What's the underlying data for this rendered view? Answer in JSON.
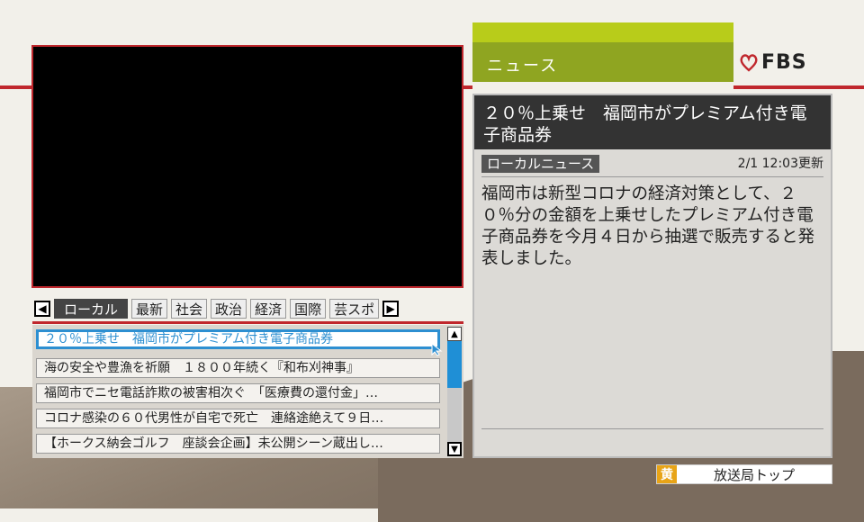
{
  "header": {
    "section_label": "ニュース",
    "logo_text": "FBS",
    "accent_color": "#8fa521",
    "brand_red": "#c0272d"
  },
  "tabs": {
    "prev_icon": "chevron-left-icon",
    "next_icon": "chevron-right-icon",
    "items": [
      {
        "label": "ローカル",
        "active": true
      },
      {
        "label": "最新"
      },
      {
        "label": "社会"
      },
      {
        "label": "政治"
      },
      {
        "label": "経済"
      },
      {
        "label": "国際"
      },
      {
        "label": "芸スポ"
      }
    ]
  },
  "news_list": {
    "items": [
      {
        "title": "２０％上乗せ　福岡市がプレミアム付き電子商品券",
        "selected": true
      },
      {
        "title": "海の安全や豊漁を祈願　１８００年続く『和布刈神事』"
      },
      {
        "title": "福岡市でニセ電話詐欺の被害相次ぐ　「医療費の還付金」…"
      },
      {
        "title": "コロナ感染の６０代男性が自宅で死亡　連絡途絶えて９日…"
      },
      {
        "title": "【ホークス納会ゴルフ　座談会企画】未公開シーン蔵出し…"
      }
    ]
  },
  "article": {
    "title": "２０％上乗せ　福岡市がプレミアム付き電子商品券",
    "category": "ローカルニュース",
    "updated": "2/1 12:03更新",
    "body": "福岡市は新型コロナの経済対策として、２０％分の金額を上乗せしたプレミアム付き電子商品券を今月４日から抽選で販売すると発表しました。"
  },
  "footer": {
    "key_label": "黄",
    "button_label": "放送局トップ",
    "key_color": "#e8a417"
  }
}
